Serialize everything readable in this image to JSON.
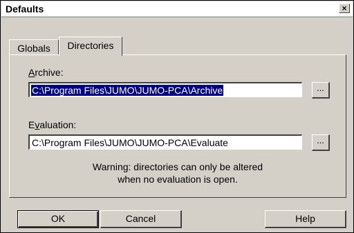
{
  "window": {
    "title": "Defaults",
    "close_glyph": "×"
  },
  "tabs": [
    {
      "label": "Globals",
      "active": false
    },
    {
      "label": "Directories",
      "active": true
    }
  ],
  "archive": {
    "label_mnemonic": "A",
    "label_rest": "rchive:",
    "value": "C:\\Program Files\\JUMO\\JUMO-PCA\\Archive",
    "selected": true,
    "browse_label": "..."
  },
  "evaluation": {
    "label_prefix": "E",
    "label_mnemonic": "v",
    "label_rest": "aluation:",
    "value": "C:\\Program Files\\JUMO\\JUMO-PCA\\Evaluate",
    "browse_label": "..."
  },
  "warning": {
    "line1": "Warning: directories can only be altered",
    "line2": "when no evaluation is open."
  },
  "buttons": {
    "ok": "OK",
    "cancel": "Cancel",
    "help": "Help"
  },
  "colors": {
    "face": "#d4d0c8",
    "selection": "#000080"
  }
}
